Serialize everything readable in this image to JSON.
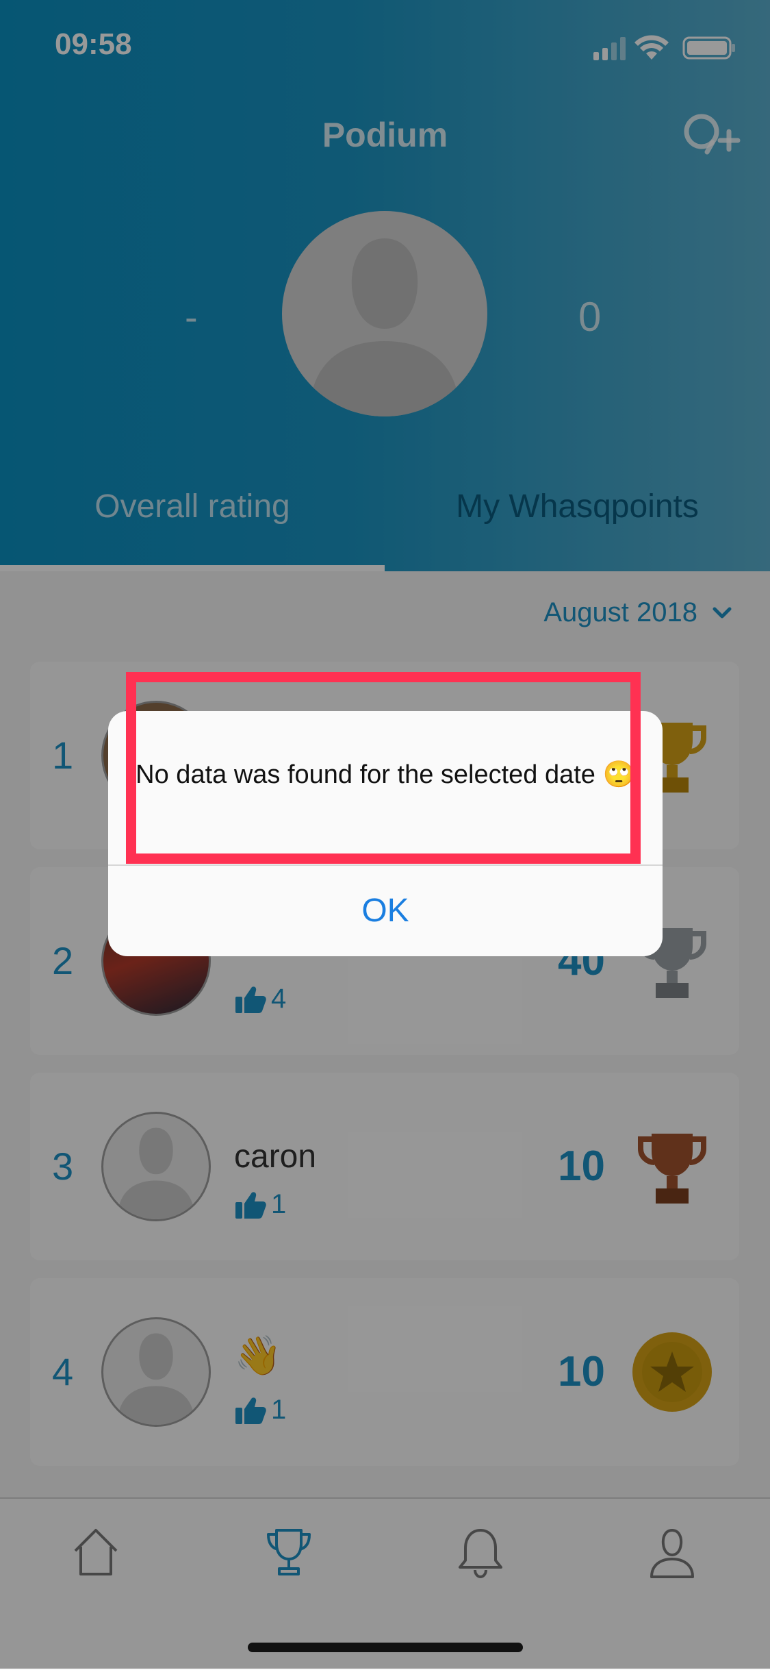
{
  "status_bar": {
    "time": "09:58"
  },
  "header": {
    "title": "Podium",
    "rank": "-",
    "points": "0",
    "tabs": [
      {
        "label": "Overall rating",
        "selected": true
      },
      {
        "label": "My Whasqpoints",
        "selected": false
      }
    ]
  },
  "filter": {
    "month": "August 2018"
  },
  "leaderboard": [
    {
      "rank": "1",
      "name": "",
      "likes": "",
      "score": "",
      "award": "gold-trophy-icon"
    },
    {
      "rank": "2",
      "name": "",
      "likes": "4",
      "score": "40",
      "award": "silver-trophy-icon"
    },
    {
      "rank": "3",
      "name": "caron",
      "likes": "1",
      "score": "10",
      "award": "bronze-trophy-icon"
    },
    {
      "rank": "4",
      "name": "👋",
      "likes": "1",
      "score": "10",
      "award": "star-medal-icon"
    }
  ],
  "dialog": {
    "message": "No data was found for the selected date 🙄",
    "ok_label": "OK"
  },
  "tabbar": {
    "items": [
      {
        "icon": "home-icon"
      },
      {
        "icon": "trophy-icon",
        "active": true
      },
      {
        "icon": "bell-icon"
      },
      {
        "icon": "profile-icon"
      }
    ]
  },
  "colors": {
    "accent": "#1d8fc4",
    "header_start": "#0b8fc0",
    "highlight": "#ff3152",
    "dialog_button": "#1a7ee0"
  }
}
